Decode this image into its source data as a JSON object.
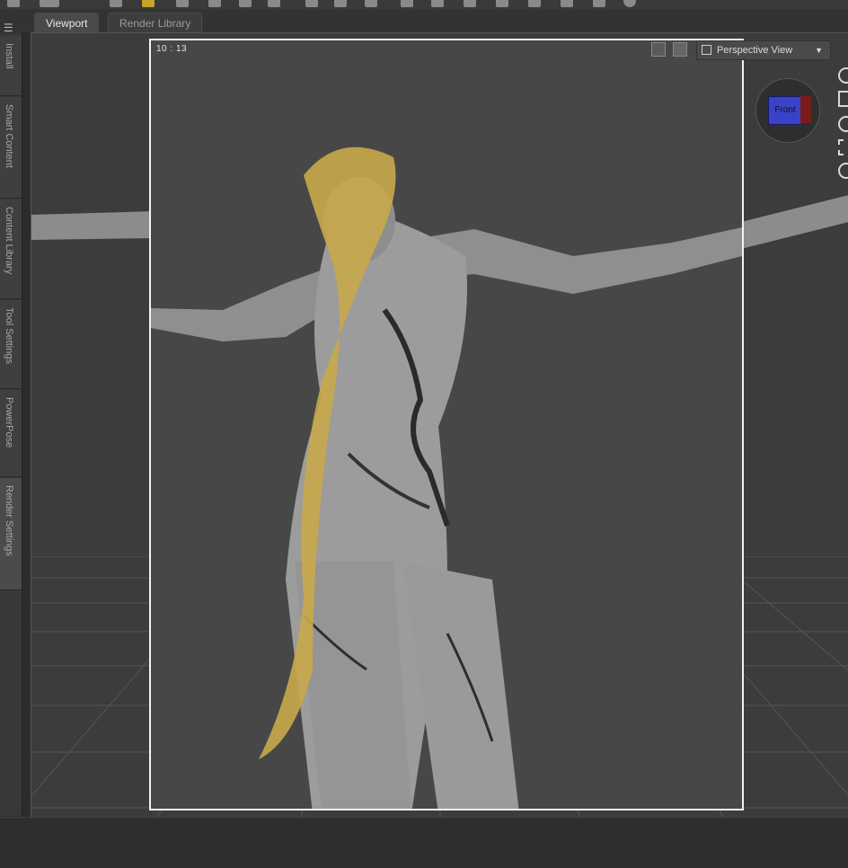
{
  "tabs": [
    "Viewport",
    "Render Library"
  ],
  "side_tabs": [
    "Install",
    "Smart Content",
    "Content Library",
    "Tool Settings",
    "PowerPose",
    "Render Settings"
  ],
  "viewport": {
    "time": "10 : 13",
    "view_mode": "Perspective View",
    "nav_cube_face": "Front"
  },
  "colors": {
    "background": "#3c3c3c",
    "render_frame": "#474747",
    "hair": "#c9a94a",
    "skin": "#9a9a9a",
    "cube_front": "#3a42c9"
  },
  "icons": {
    "panel_menu": "panel-menu-icon",
    "view_mode": "frame-icon",
    "aux_camera": "camera-icon",
    "cube_nav": "view-cube-icon",
    "orbit": "orbit-icon",
    "pan": "pan-icon",
    "zoom": "zoom-icon",
    "frame": "frame-icon",
    "reset": "reset-view-icon"
  }
}
